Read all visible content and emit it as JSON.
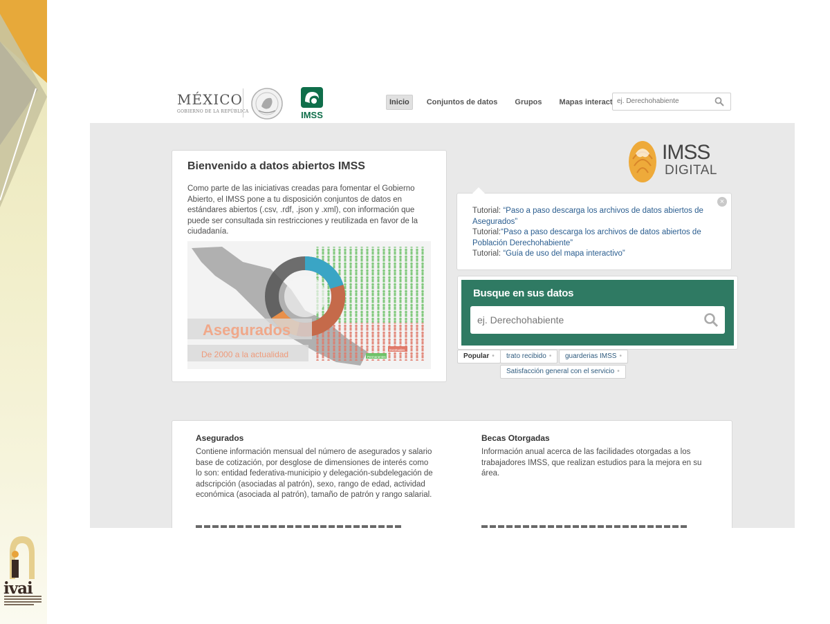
{
  "header": {
    "mexico_word": "MÉXICO",
    "mexico_sub": "GOBIERNO DE LA REPÚBLICA",
    "imss_logo_text": "IMSS",
    "nav": [
      {
        "label": "Inicio",
        "active": true
      },
      {
        "label": "Conjuntos de datos",
        "active": false
      },
      {
        "label": "Grupos",
        "active": false
      },
      {
        "label": "Mapas interactivos",
        "active": false
      }
    ],
    "search_placeholder": "ej. Derechohabiente"
  },
  "welcome": {
    "title": "Bienvenido a datos abiertos IMSS",
    "text": "Como parte de las iniciativas creadas para fomentar el Gobierno Abierto, el IMSS pone a tu disposición conjuntos de datos en estándares abiertos (.csv, .rdf, .json y .xml), con información que puede ser consultada sin restricciones y reutilizada en favor de la ciudadanía.",
    "infographic_title": "Asegurados",
    "infographic_subtitle": "De 2000 a la actualidad",
    "infographic_legend": [
      "Permanentes",
      "Eventuales"
    ]
  },
  "imss_digital": {
    "word1": "IMSS",
    "word2": "DIGITAL"
  },
  "tutorials": {
    "close_symbol": "×",
    "items": [
      {
        "prefix": "Tutorial: ",
        "link": "“Paso a paso descarga los archivos de datos abiertos de Asegurados”"
      },
      {
        "prefix": "Tutorial:",
        "link": "“Paso a paso descarga los archivos de datos abiertos de Población Derechohabiente”"
      },
      {
        "prefix": "Tutorial: ",
        "link": "“Guía de uso del mapa interactivo”"
      }
    ]
  },
  "search_panel": {
    "title": "Busque en sus datos",
    "placeholder": "ej. Derechohabiente"
  },
  "tags": {
    "popular_label": "Popular",
    "items": [
      "trato recibido",
      "guarderias IMSS",
      "Satisfacción general con el servicio"
    ]
  },
  "datasets": [
    {
      "title": "Asegurados",
      "description": "Contiene información mensual del número de asegurados y salario base de cotización, por desglose de dimensiones de interés como lo son: entidad federativa-municipio y delegación-subdelegación de adscripción (asociadas al patrón), sexo, rango de edad, actividad económica (asociada al patrón), tamaño de patrón y rango salarial."
    },
    {
      "title": "Becas Otorgadas",
      "description": "Información anual acerca de las facilidades otorgadas a los trabajadores IMSS, que realizan estudios para la mejora en su área."
    }
  ],
  "ivai": {
    "word": "ivai"
  },
  "colors": {
    "green": "#2f7a63",
    "link": "#2a5d8f",
    "gray_bg": "#e9e9e9",
    "imss_green": "#0f6e4a"
  }
}
